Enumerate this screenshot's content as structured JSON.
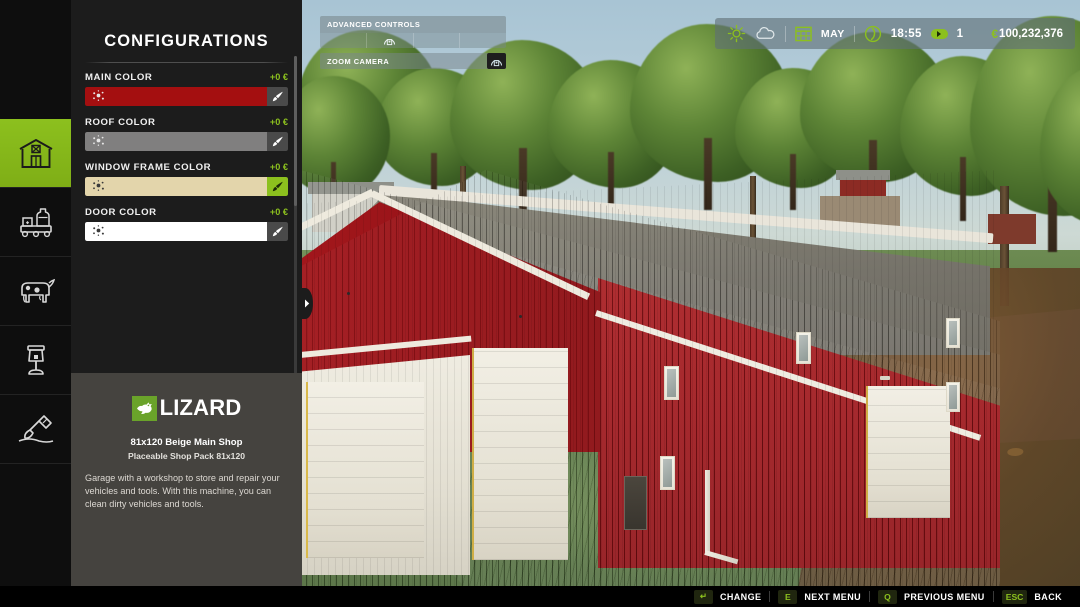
{
  "panel": {
    "title": "CONFIGURATIONS",
    "rows": [
      {
        "label": "MAIN COLOR",
        "price": "+0 €",
        "color": "#a40f10",
        "selected": false,
        "icon": "paint-splatter-icon"
      },
      {
        "label": "ROOF COLOR",
        "price": "+0 €",
        "color": "#807f7f",
        "selected": false,
        "icon": "paint-splatter-icon"
      },
      {
        "label": "WINDOW FRAME COLOR",
        "price": "+0 €",
        "color": "#e3d5ab",
        "selected": true,
        "icon": "paint-splatter-icon"
      },
      {
        "label": "DOOR COLOR",
        "price": "+0 €",
        "color": "#ffffff",
        "selected": false,
        "icon": "paint-splatter-icon"
      }
    ]
  },
  "sidebar": {
    "items": [
      {
        "name": "buildings",
        "icon": "barn-icon",
        "active": true
      },
      {
        "name": "production",
        "icon": "production-icon",
        "active": false
      },
      {
        "name": "animals",
        "icon": "cow-icon",
        "active": false
      },
      {
        "name": "decorations",
        "icon": "lamp-icon",
        "active": false
      },
      {
        "name": "terrain",
        "icon": "shovel-icon",
        "active": false
      }
    ]
  },
  "details": {
    "brand": "LIZARD",
    "brand_icon": "lizard-icon",
    "item_name": "81x120 Beige Main Shop",
    "item_subtitle": "Placeable Shop Pack 81x120",
    "description": "Garage with a workshop to store and repair your vehicles and tools. With this machine, you can clean dirty vehicles and tools."
  },
  "advanced_controls": {
    "title": "ADVANCED CONTROLS",
    "cells": [
      "",
      "camera-icon",
      "",
      ""
    ],
    "zoom_label": "ZOOM CAMERA",
    "zoom_key_icon": "camera-icon"
  },
  "hud": {
    "weather_icons": [
      "sun-icon",
      "cloud-icon"
    ],
    "calendar_icon": "calendar-icon",
    "month": "MAY",
    "clock_icon": "clock-icon",
    "time": "18:55",
    "speed_icon": "play-speed-icon",
    "speed": "1",
    "currency_symbol": "€",
    "money": "100,232,376"
  },
  "bottom_bar": {
    "hints": [
      {
        "key": "↵",
        "label": "CHANGE"
      },
      {
        "key": "E",
        "label": "NEXT MENU"
      },
      {
        "key": "Q",
        "label": "PREVIOUS MENU"
      },
      {
        "key": "ESC",
        "label": "BACK"
      }
    ]
  },
  "colors": {
    "accent_green": "#8cc01e",
    "panel_bg": "#1c1c1c",
    "desc_bg": "#45433f",
    "rail_bg": "#0e0e0e"
  }
}
